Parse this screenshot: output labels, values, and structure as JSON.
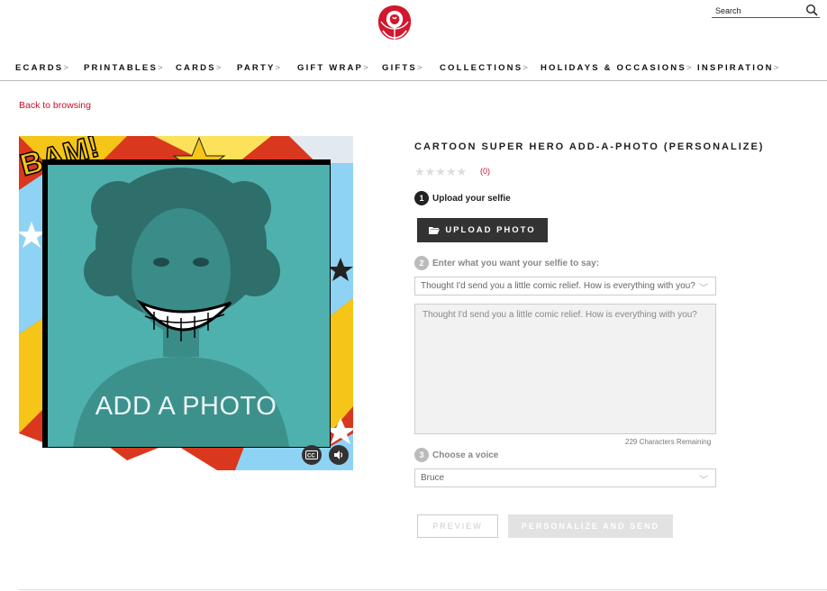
{
  "header": {
    "logo_icon": "rose-icon",
    "search": {
      "placeholder": "Search",
      "icon": "search-icon"
    }
  },
  "nav": {
    "items": [
      {
        "label": "ECARDS"
      },
      {
        "label": "PRINTABLES"
      },
      {
        "label": "CARDS"
      },
      {
        "label": "PARTY"
      },
      {
        "label": "GIFT WRAP"
      },
      {
        "label": "GIFTS"
      },
      {
        "label": "COLLECTIONS"
      },
      {
        "label": "HOLIDAYS & OCCASIONS"
      },
      {
        "label": "INSPIRATION"
      }
    ],
    "chevron": ">"
  },
  "back_link": "Back to browsing",
  "card_image": {
    "overlay_text": "ADD A PHOTO",
    "photo_tint": "#4fb1ad",
    "controls": [
      "captions-icon",
      "volume-icon"
    ]
  },
  "product": {
    "title": "CARTOON SUPER HERO ADD-A-PHOTO (PERSONALIZE)",
    "rating": {
      "stars": "★★★★★",
      "count": "(0)"
    }
  },
  "steps": {
    "step1": {
      "num": "1",
      "label": "Upload your selfie"
    },
    "upload_button": "UPLOAD PHOTO",
    "step2": {
      "num": "2",
      "label": "Enter what you want your selfie to say:"
    },
    "message_select": "Thought I'd send you a little comic relief. How is everything with you?",
    "message_text": "Thought I'd send you a little comic relief. How is everything with you?",
    "chars_remaining": "229 Characters Remaining",
    "step3": {
      "num": "3",
      "label": "Choose a voice"
    },
    "voice_select": "Bruce"
  },
  "actions": {
    "preview": "PREVIEW",
    "send": "PERSONALIZE AND SEND"
  },
  "colors": {
    "brand_red": "#c8102e",
    "dark_button": "#333333"
  }
}
